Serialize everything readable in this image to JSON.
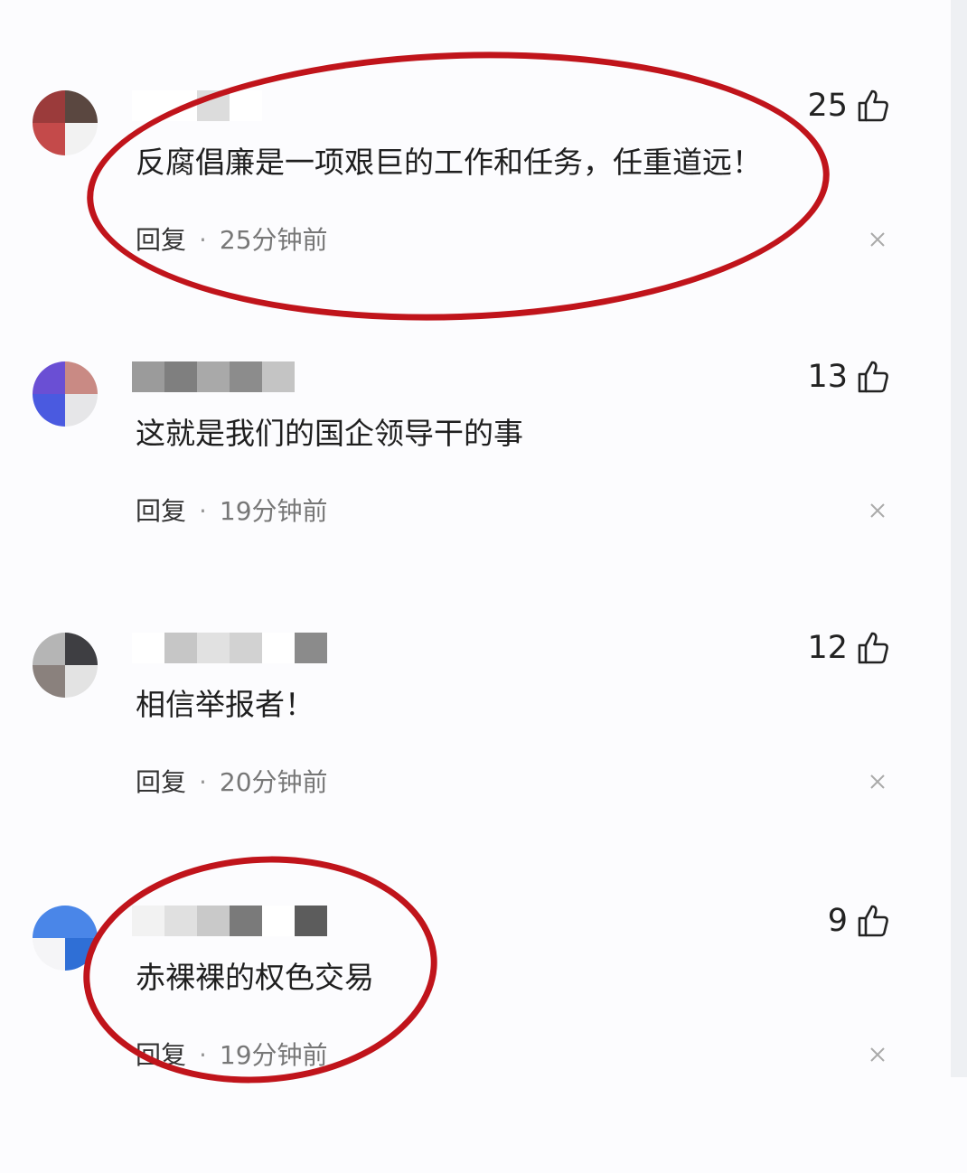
{
  "comments": [
    {
      "text": "反腐倡廉是一项艰巨的工作和任务，任重道远！",
      "reply_label": "回复",
      "time": "25分钟前",
      "likes": "25",
      "avatar_colors": [
        "#9b3b3b",
        "#5a4740",
        "#c44a4a",
        "#f2f2f2"
      ],
      "name_blocks": [
        "#ffffff",
        "#ffffff",
        "#dcdcdc",
        "#ffffff"
      ]
    },
    {
      "text": "这就是我们的国企领导干的事",
      "reply_label": "回复",
      "time": "19分钟前",
      "likes": "13",
      "avatar_colors": [
        "#6a4fd4",
        "#c98a84",
        "#4a5ae0",
        "#e6e6e8"
      ],
      "name_blocks": [
        "#9b9b9b",
        "#7f7f7f",
        "#a9a9a9",
        "#8c8c8c",
        "#c4c4c4"
      ]
    },
    {
      "text": "相信举报者！",
      "reply_label": "回复",
      "time": "20分钟前",
      "likes": "12",
      "avatar_colors": [
        "#b5b5b5",
        "#3e3e42",
        "#8a817d",
        "#e3e3e3"
      ],
      "name_blocks": [
        "#ffffff",
        "#c6c6c6",
        "#e1e1e1",
        "#d2d2d2",
        "#ffffff",
        "#8b8b8b"
      ]
    },
    {
      "text": "赤裸裸的权色交易",
      "reply_label": "回复",
      "time": "19分钟前",
      "likes": "9",
      "avatar_colors": [
        "#4a86e8",
        "#4a86e8",
        "#f5f5f7",
        "#2f6fd6"
      ],
      "name_blocks": [
        "#f2f2f2",
        "#e0e0e0",
        "#c9c9c9",
        "#7a7a7a",
        "#ffffff",
        "#5c5c5c"
      ]
    }
  ],
  "colors": {
    "highlight": "#c0141b"
  }
}
